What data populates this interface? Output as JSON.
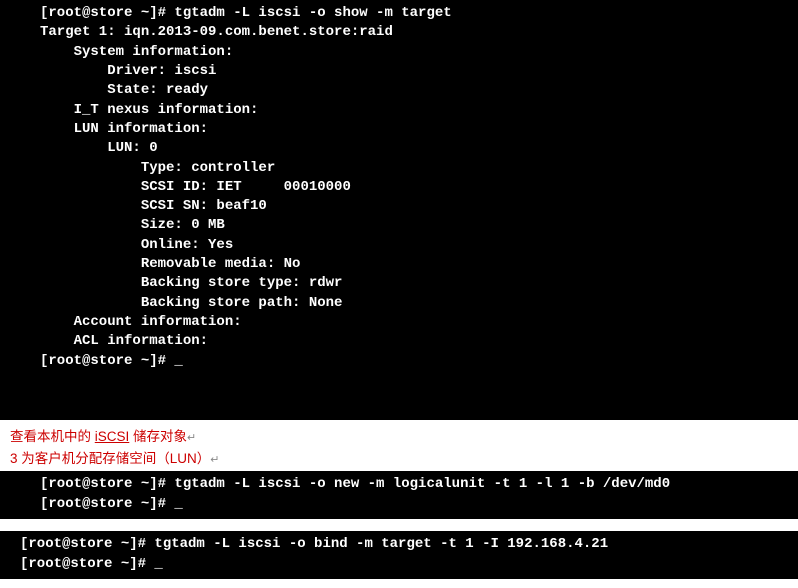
{
  "terminal1": {
    "prompt1": "[root@store ~]# ",
    "cmd1": "tgtadm -L iscsi -o show -m target",
    "out": "Target 1: iqn.2013-09.com.benet.store:raid\n    System information:\n        Driver: iscsi\n        State: ready\n    I_T nexus information:\n    LUN information:\n        LUN: 0\n            Type: controller\n            SCSI ID: IET     00010000\n            SCSI SN: beaf10\n            Size: 0 MB\n            Online: Yes\n            Removable media: No\n            Backing store type: rdwr\n            Backing store path: None\n    Account information:\n    ACL information:",
    "prompt2": "[root@store ~]# "
  },
  "annotation": {
    "line1_pre": "查看本机中的 ",
    "line1_link": "iSCSI",
    "line1_post": " 储存对象",
    "line2": "3 为客户机分配存储空间（LUN）",
    "arrow": "↵"
  },
  "terminal2": {
    "prompt1": "[root@store ~]# ",
    "cmd1": "tgtadm -L iscsi -o new -m logicalunit -t 1 -l 1 -b /dev/md0",
    "prompt2": "[root@store ~]# "
  },
  "terminal3": {
    "prompt1": "[root@store ~]# ",
    "cmd1": "tgtadm -L iscsi -o bind -m target -t 1 -I 192.168.4.21",
    "prompt2": "[root@store ~]# "
  }
}
